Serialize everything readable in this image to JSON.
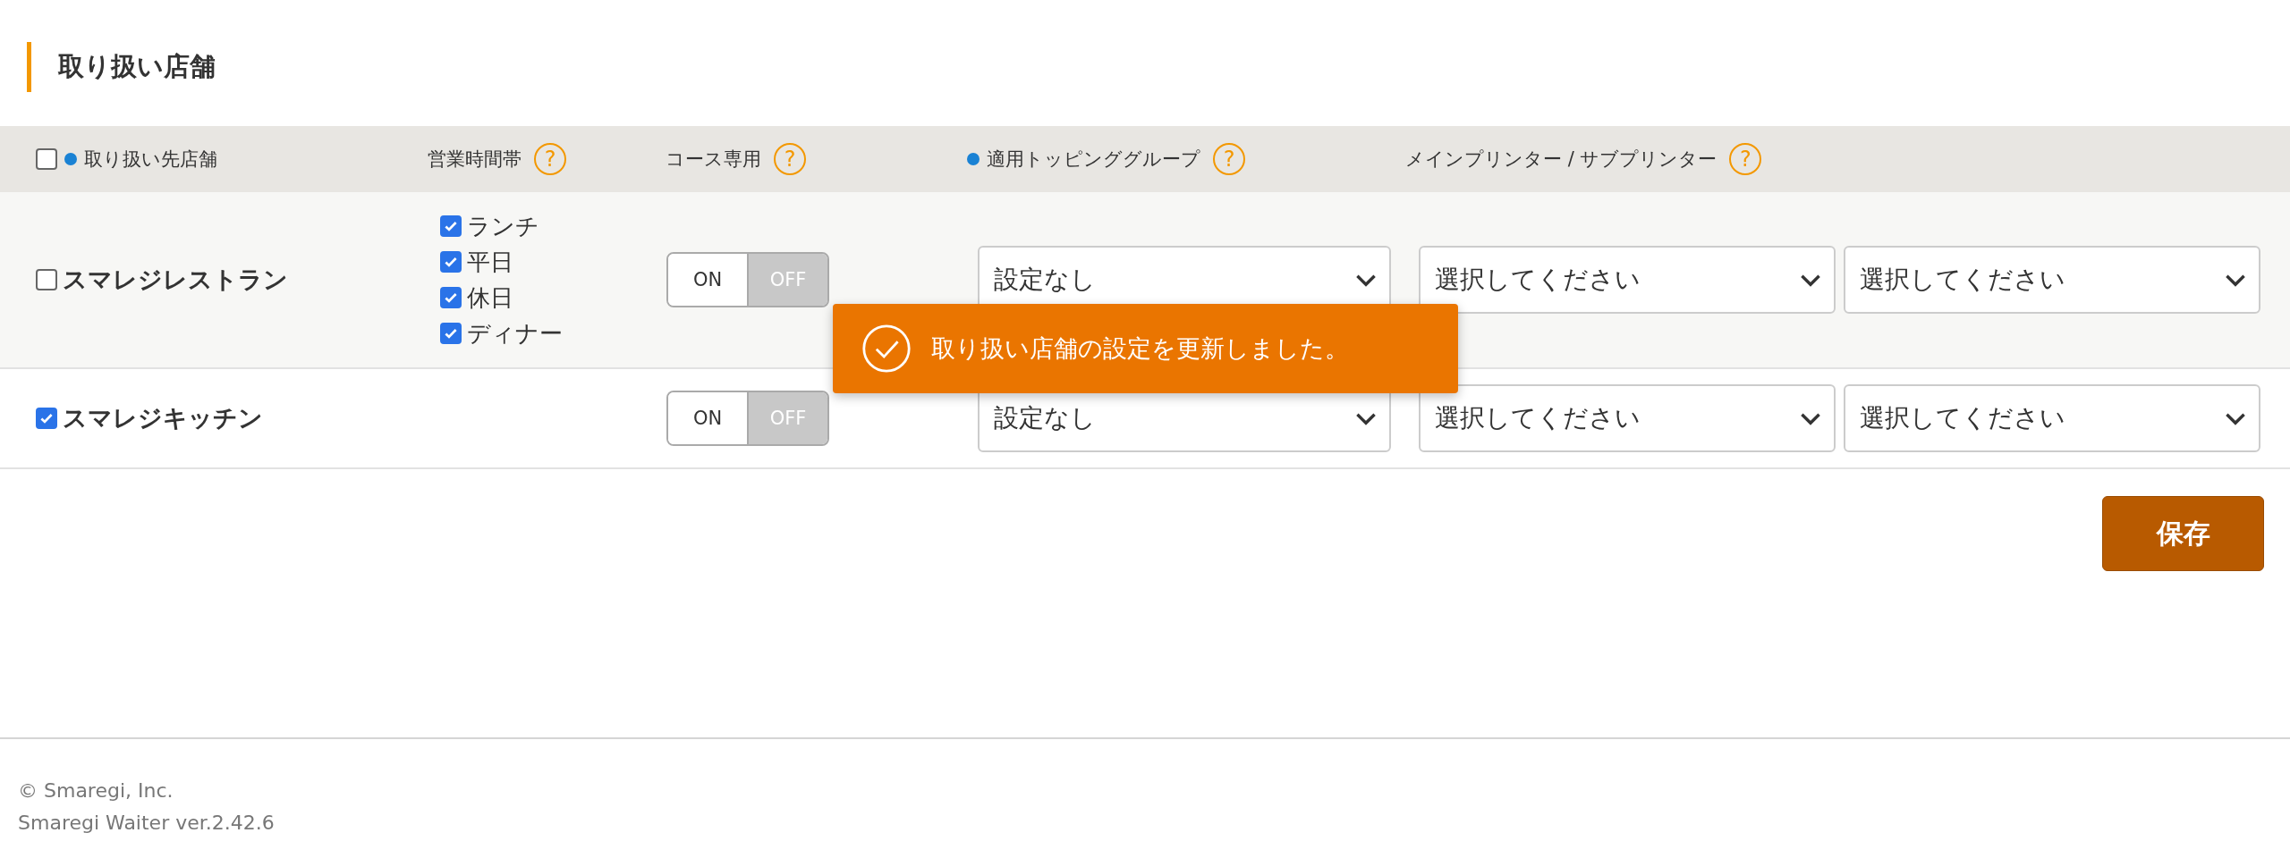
{
  "title": "取り扱い店舗",
  "header": {
    "select_all": {
      "checked": false
    },
    "columns": [
      {
        "label": "取り扱い先店舗",
        "required": true
      },
      {
        "label": "営業時間帯",
        "required": false,
        "help": "?"
      },
      {
        "label": "コース専用",
        "required": false,
        "help": "?"
      },
      {
        "label": "適用トッピンググループ",
        "required": true,
        "help": "?"
      },
      {
        "label": "メインプリンター / サブプリンター",
        "required": false,
        "help": "?"
      }
    ]
  },
  "rows": [
    {
      "name": "スマレジレストラン",
      "checked": false,
      "hours": [
        {
          "label": "ランチ",
          "checked": true
        },
        {
          "label": "平日",
          "checked": true
        },
        {
          "label": "休日",
          "checked": true
        },
        {
          "label": "ディナー",
          "checked": true
        }
      ],
      "toggle": {
        "on_label": "ON",
        "off_label": "OFF",
        "on": false
      },
      "topping_group": "設定なし",
      "printers": [
        "選択してください",
        "選択してください"
      ]
    },
    {
      "name": "スマレジキッチン",
      "checked": true,
      "hours": [],
      "toggle": {
        "on_label": "ON",
        "off_label": "OFF",
        "on": false
      },
      "topping_group": "設定なし",
      "printers": [
        "選択してください",
        "選択してください"
      ]
    }
  ],
  "toast": {
    "kind": "success",
    "message": "取り扱い店舗の設定を更新しました。"
  },
  "save_button": "保存",
  "footer": [
    "© Smaregi, Inc.",
    "Smaregi Waiter ver.2.42.6"
  ]
}
